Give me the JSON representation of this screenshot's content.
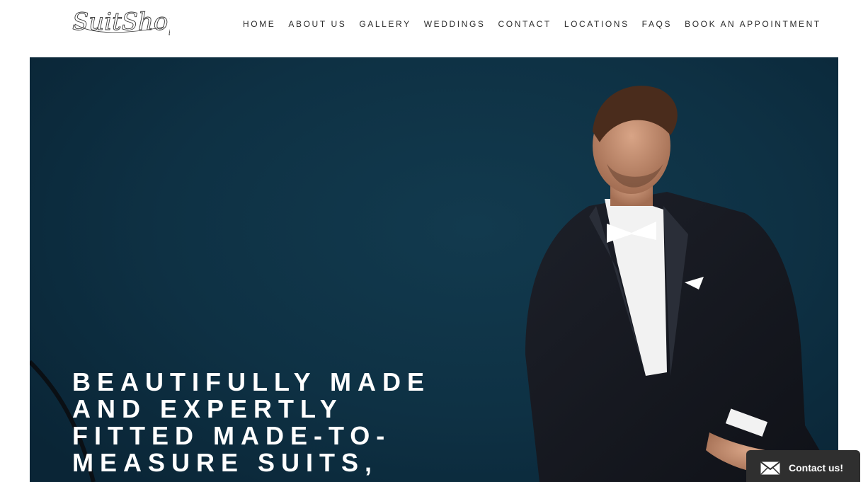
{
  "header": {
    "logo_text": "SuitShop",
    "nav": [
      {
        "label": "HOME"
      },
      {
        "label": "ABOUT US"
      },
      {
        "label": "GALLERY"
      },
      {
        "label": "WEDDINGS"
      },
      {
        "label": "CONTACT"
      },
      {
        "label": "LOCATIONS"
      },
      {
        "label": "FAQS"
      },
      {
        "label": "BOOK AN APPOINTMENT"
      }
    ]
  },
  "hero": {
    "headline_lines": [
      "BEAUTIFULLY MADE",
      "AND EXPERTLY",
      "FITTED MADE-TO-",
      "MEASURE SUITS,"
    ],
    "background_color": "#0e3144"
  },
  "contact_widget": {
    "label": "Contact us!",
    "icon": "mail-icon",
    "background_color": "#2f2f2f"
  }
}
